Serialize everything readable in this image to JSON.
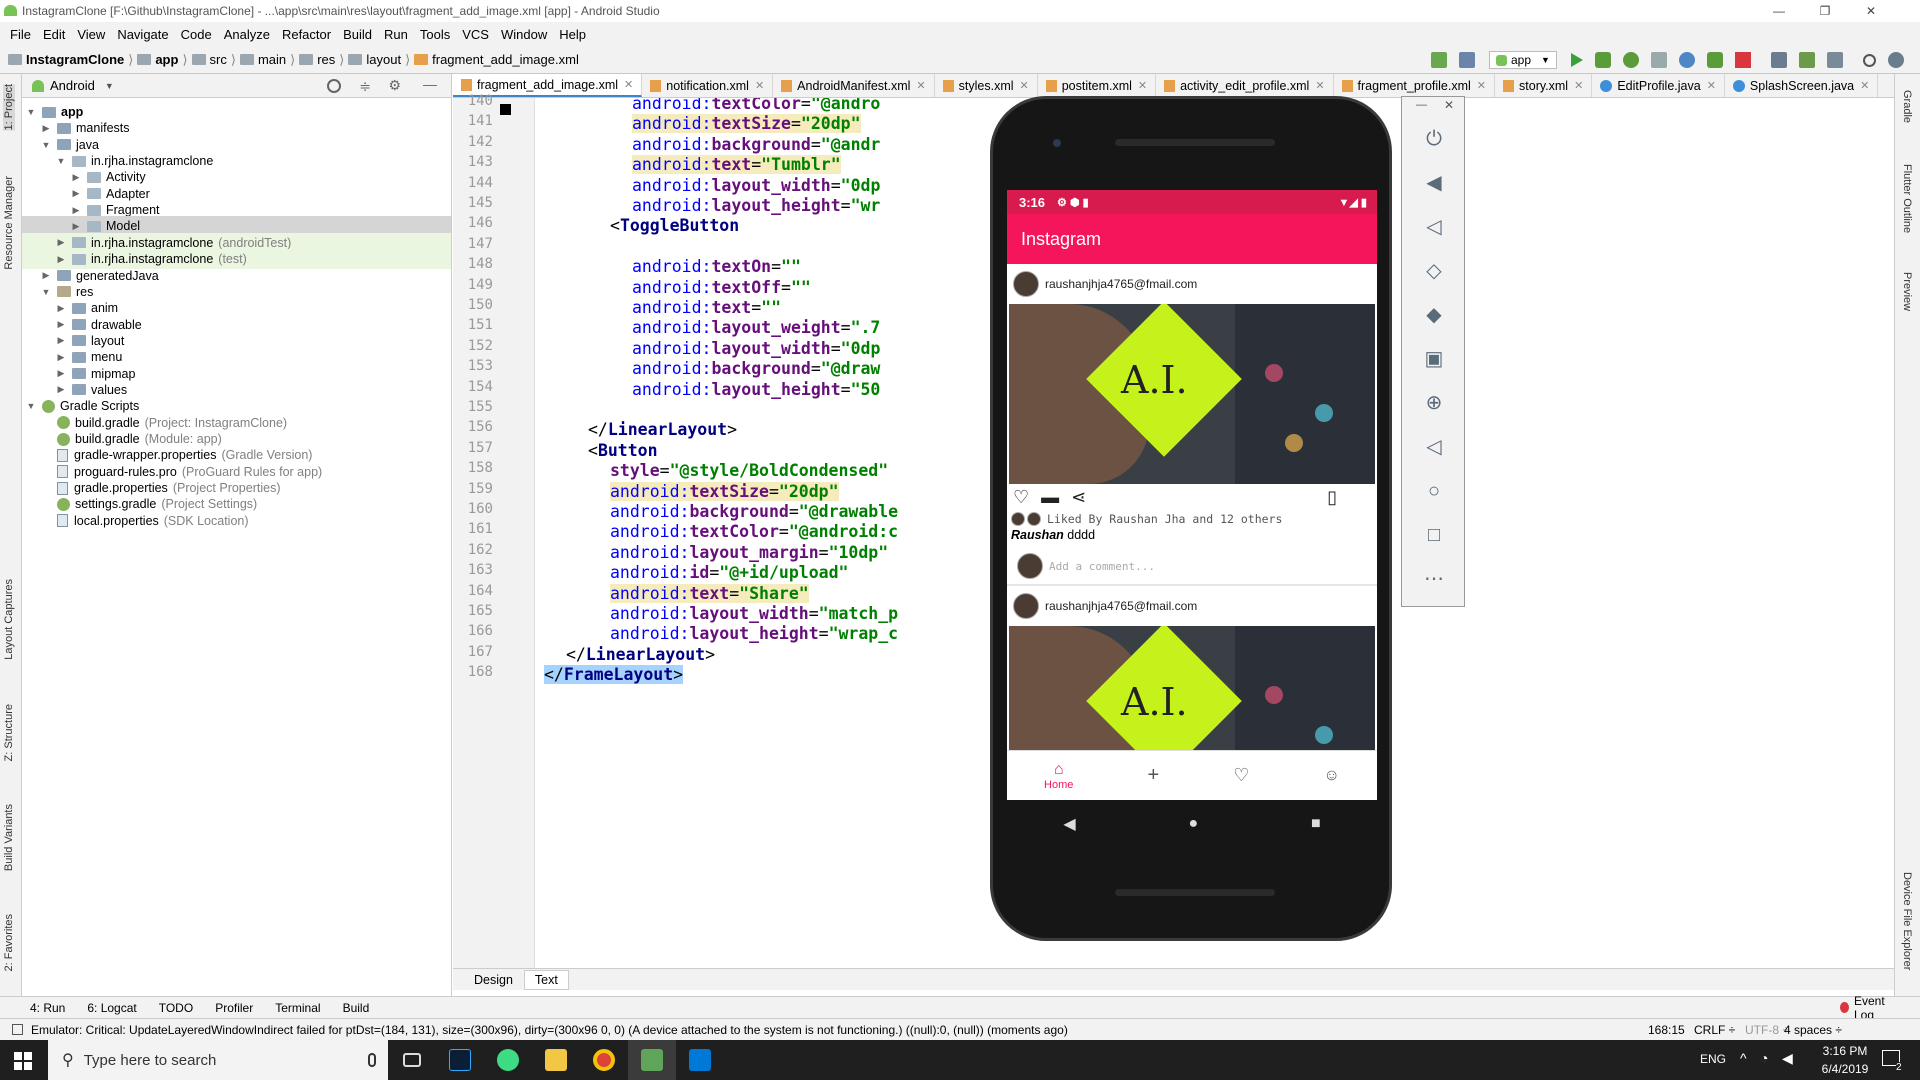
{
  "window": {
    "title": "InstagramClone [F:\\Github\\InstagramClone] - ...\\app\\src\\main\\res\\layout\\fragment_add_image.xml [app] - Android Studio",
    "controls": [
      "—",
      "❐",
      "✕"
    ]
  },
  "menu": [
    "File",
    "Edit",
    "View",
    "Navigate",
    "Code",
    "Analyze",
    "Refactor",
    "Build",
    "Run",
    "Tools",
    "VCS",
    "Window",
    "Help"
  ],
  "breadcrumb": [
    "InstagramClone",
    "app",
    "src",
    "main",
    "res",
    "layout",
    "fragment_add_image.xml"
  ],
  "run_config": "app",
  "left_tools": [
    "1: Project",
    "Resource Manager",
    "Layout Captures",
    "Z: Structure",
    "Build Variants",
    "2: Favorites"
  ],
  "project": {
    "view_selector": "Android",
    "tree": [
      {
        "label": "app",
        "level": 0,
        "arrow": "▼",
        "icon": "fold",
        "bold": true
      },
      {
        "label": "manifests",
        "level": 1,
        "arrow": "▶",
        "icon": "fold"
      },
      {
        "label": "java",
        "level": 1,
        "arrow": "▼",
        "icon": "fold"
      },
      {
        "label": "in.rjha.instagramclone",
        "level": 2,
        "arrow": "▼",
        "icon": "pkg"
      },
      {
        "label": "Activity",
        "level": 3,
        "arrow": "▶",
        "icon": "pkg"
      },
      {
        "label": "Adapter",
        "level": 3,
        "arrow": "▶",
        "icon": "pkg"
      },
      {
        "label": "Fragment",
        "level": 3,
        "arrow": "▶",
        "icon": "pkg"
      },
      {
        "label": "Model",
        "level": 3,
        "arrow": "▶",
        "icon": "pkg",
        "selected": true
      },
      {
        "label": "in.rjha.instagramclone",
        "hint": "(androidTest)",
        "level": 2,
        "arrow": "▶",
        "icon": "pkg",
        "green": true
      },
      {
        "label": "in.rjha.instagramclone",
        "hint": "(test)",
        "level": 2,
        "arrow": "▶",
        "icon": "pkg",
        "green": true
      },
      {
        "label": "generatedJava",
        "level": 1,
        "arrow": "▶",
        "icon": "fold"
      },
      {
        "label": "res",
        "level": 1,
        "arrow": "▼",
        "icon": "res"
      },
      {
        "label": "anim",
        "level": 2,
        "arrow": "▶",
        "icon": "fold"
      },
      {
        "label": "drawable",
        "level": 2,
        "arrow": "▶",
        "icon": "fold"
      },
      {
        "label": "layout",
        "level": 2,
        "arrow": "▶",
        "icon": "fold"
      },
      {
        "label": "menu",
        "level": 2,
        "arrow": "▶",
        "icon": "fold"
      },
      {
        "label": "mipmap",
        "level": 2,
        "arrow": "▶",
        "icon": "fold"
      },
      {
        "label": "values",
        "level": 2,
        "arrow": "▶",
        "icon": "fold"
      },
      {
        "label": "Gradle Scripts",
        "level": 0,
        "arrow": "▼",
        "icon": "gr"
      },
      {
        "label": "build.gradle",
        "hint": "(Project: InstagramClone)",
        "level": 1,
        "arrow": "",
        "icon": "gr"
      },
      {
        "label": "build.gradle",
        "hint": "(Module: app)",
        "level": 1,
        "arrow": "",
        "icon": "gr"
      },
      {
        "label": "gradle-wrapper.properties",
        "hint": "(Gradle Version)",
        "level": 1,
        "arrow": "",
        "icon": "file"
      },
      {
        "label": "proguard-rules.pro",
        "hint": "(ProGuard Rules for app)",
        "level": 1,
        "arrow": "",
        "icon": "file"
      },
      {
        "label": "gradle.properties",
        "hint": "(Project Properties)",
        "level": 1,
        "arrow": "",
        "icon": "file"
      },
      {
        "label": "settings.gradle",
        "hint": "(Project Settings)",
        "level": 1,
        "arrow": "",
        "icon": "gr"
      },
      {
        "label": "local.properties",
        "hint": "(SDK Location)",
        "level": 1,
        "arrow": "",
        "icon": "file"
      }
    ]
  },
  "tabs": [
    {
      "label": "fragment_add_image.xml",
      "active": true,
      "kind": "xml"
    },
    {
      "label": "notification.xml",
      "kind": "xml"
    },
    {
      "label": "AndroidManifest.xml",
      "kind": "xml"
    },
    {
      "label": "styles.xml",
      "kind": "xml"
    },
    {
      "label": "postitem.xml",
      "kind": "xml"
    },
    {
      "label": "activity_edit_profile.xml",
      "kind": "xml"
    },
    {
      "label": "fragment_profile.xml",
      "kind": "xml"
    },
    {
      "label": "story.xml",
      "kind": "xml"
    },
    {
      "label": "EditProfile.java",
      "kind": "java"
    },
    {
      "label": "SplashScreen.java",
      "kind": "java"
    }
  ],
  "code": [
    {
      "n": 140,
      "indent": 8,
      "parts": [
        [
          "at2",
          "android:"
        ],
        [
          "at",
          "textColor"
        ],
        [
          "",
          "="
        ],
        [
          "val",
          "\"@andro"
        ]
      ]
    },
    {
      "n": 141,
      "indent": 8,
      "hl": true,
      "parts": [
        [
          "at2",
          "android:"
        ],
        [
          "at",
          "textSize"
        ],
        [
          "",
          "="
        ],
        [
          "val",
          "\"20dp\""
        ]
      ]
    },
    {
      "n": 142,
      "indent": 8,
      "parts": [
        [
          "at2",
          "android:"
        ],
        [
          "at",
          "background"
        ],
        [
          "",
          "="
        ],
        [
          "val",
          "\"@andr"
        ]
      ]
    },
    {
      "n": 143,
      "indent": 8,
      "hl": true,
      "parts": [
        [
          "at2",
          "android:"
        ],
        [
          "at",
          "text"
        ],
        [
          "",
          "="
        ],
        [
          "val",
          "\"Tumblr\""
        ]
      ]
    },
    {
      "n": 144,
      "indent": 8,
      "parts": [
        [
          "at2",
          "android:"
        ],
        [
          "at",
          "layout_width"
        ],
        [
          "",
          "="
        ],
        [
          "val",
          "\"0dp"
        ]
      ]
    },
    {
      "n": 145,
      "indent": 8,
      "parts": [
        [
          "at2",
          "android:"
        ],
        [
          "at",
          "layout_height"
        ],
        [
          "",
          "="
        ],
        [
          "val",
          "\"wr"
        ]
      ]
    },
    {
      "n": 146,
      "indent": 6,
      "parts": [
        [
          "",
          "<"
        ],
        [
          "tag",
          "ToggleButton"
        ]
      ]
    },
    {
      "n": 147,
      "indent": 0,
      "parts": []
    },
    {
      "n": 148,
      "indent": 8,
      "parts": [
        [
          "at2",
          "android:"
        ],
        [
          "at",
          "textOn"
        ],
        [
          "",
          "="
        ],
        [
          "val",
          "\"\""
        ]
      ]
    },
    {
      "n": 149,
      "indent": 8,
      "parts": [
        [
          "at2",
          "android:"
        ],
        [
          "at",
          "textOff"
        ],
        [
          "",
          "="
        ],
        [
          "val",
          "\"\""
        ]
      ]
    },
    {
      "n": 150,
      "indent": 8,
      "parts": [
        [
          "at2",
          "android:"
        ],
        [
          "at",
          "text"
        ],
        [
          "",
          "="
        ],
        [
          "val",
          "\"\""
        ]
      ]
    },
    {
      "n": 151,
      "indent": 8,
      "parts": [
        [
          "at2",
          "android:"
        ],
        [
          "at",
          "layout_weight"
        ],
        [
          "",
          "="
        ],
        [
          "val",
          "\".7"
        ]
      ]
    },
    {
      "n": 152,
      "indent": 8,
      "parts": [
        [
          "at2",
          "android:"
        ],
        [
          "at",
          "layout_width"
        ],
        [
          "",
          "="
        ],
        [
          "val",
          "\"0dp"
        ]
      ]
    },
    {
      "n": 153,
      "indent": 8,
      "parts": [
        [
          "at2",
          "android:"
        ],
        [
          "at",
          "background"
        ],
        [
          "",
          "="
        ],
        [
          "val",
          "\"@draw"
        ]
      ]
    },
    {
      "n": 154,
      "indent": 8,
      "parts": [
        [
          "at2",
          "android:"
        ],
        [
          "at",
          "layout_height"
        ],
        [
          "",
          "="
        ],
        [
          "val",
          "\"50"
        ]
      ]
    },
    {
      "n": 155,
      "indent": 0,
      "parts": []
    },
    {
      "n": 156,
      "indent": 4,
      "parts": [
        [
          "",
          "</"
        ],
        [
          "tag",
          "LinearLayout"
        ],
        [
          "",
          ">"
        ]
      ]
    },
    {
      "n": 157,
      "indent": 4,
      "parts": [
        [
          "",
          "<"
        ],
        [
          "tag",
          "Button"
        ]
      ]
    },
    {
      "n": 158,
      "indent": 6,
      "parts": [
        [
          "at",
          "style"
        ],
        [
          "",
          "="
        ],
        [
          "val",
          "\"@style/BoldCondensed\""
        ]
      ]
    },
    {
      "n": 159,
      "indent": 6,
      "hl": true,
      "parts": [
        [
          "at2",
          "android:"
        ],
        [
          "at",
          "textSize"
        ],
        [
          "",
          "="
        ],
        [
          "val",
          "\"20dp\""
        ]
      ]
    },
    {
      "n": 160,
      "indent": 6,
      "parts": [
        [
          "at2",
          "android:"
        ],
        [
          "at",
          "background"
        ],
        [
          "",
          "="
        ],
        [
          "val",
          "\"@drawable"
        ]
      ]
    },
    {
      "n": 161,
      "indent": 6,
      "parts": [
        [
          "at2",
          "android:"
        ],
        [
          "at",
          "textColor"
        ],
        [
          "",
          "="
        ],
        [
          "val",
          "\"@android:c"
        ]
      ]
    },
    {
      "n": 162,
      "indent": 6,
      "parts": [
        [
          "at2",
          "android:"
        ],
        [
          "at",
          "layout_margin"
        ],
        [
          "",
          "="
        ],
        [
          "val",
          "\"10dp\""
        ]
      ]
    },
    {
      "n": 163,
      "indent": 6,
      "parts": [
        [
          "at2",
          "android:"
        ],
        [
          "at",
          "id"
        ],
        [
          "",
          "="
        ],
        [
          "val",
          "\"@+id/upload\""
        ]
      ]
    },
    {
      "n": 164,
      "indent": 6,
      "hl": true,
      "parts": [
        [
          "at2",
          "android:"
        ],
        [
          "at",
          "text"
        ],
        [
          "",
          "="
        ],
        [
          "val",
          "\"Share\""
        ]
      ]
    },
    {
      "n": 165,
      "indent": 6,
      "parts": [
        [
          "at2",
          "android:"
        ],
        [
          "at",
          "layout_width"
        ],
        [
          "",
          "="
        ],
        [
          "val",
          "\"match_p"
        ]
      ]
    },
    {
      "n": 166,
      "indent": 6,
      "parts": [
        [
          "at2",
          "android:"
        ],
        [
          "at",
          "layout_height"
        ],
        [
          "",
          "="
        ],
        [
          "val",
          "\"wrap_c"
        ]
      ]
    },
    {
      "n": 167,
      "indent": 2,
      "parts": [
        [
          "",
          "</"
        ],
        [
          "tag",
          "LinearLayout"
        ],
        [
          "",
          ">"
        ]
      ]
    },
    {
      "n": 168,
      "indent": 0,
      "sel": true,
      "parts": [
        [
          "",
          "</"
        ],
        [
          "tag",
          "FrameLayout"
        ],
        [
          "",
          ">"
        ]
      ]
    }
  ],
  "design_tabs": [
    "Design",
    "Text"
  ],
  "right_tools": [
    "Gradle",
    "Flutter Outline",
    "Preview",
    "Device File Explorer"
  ],
  "bottom_tools": [
    "4: Run",
    "6: Logcat",
    "TODO",
    "Profiler",
    "Terminal",
    "Build"
  ],
  "event_log": "Event Log",
  "status": {
    "message": "Emulator: Critical: UpdateLayeredWindowIndirect failed for ptDst=(184, 131), size=(300x96), dirty=(300x96 0, 0) (A device attached to the system is not functioning.) ((null):0, (null)) (moments ago)",
    "position": "168:15",
    "line_sep": "CRLF ÷",
    "encoding": "UTF-8 ÷",
    "indent": "4 spaces ÷"
  },
  "phone": {
    "time": "3:16",
    "app_title": "Instagram",
    "posts": [
      {
        "user": "raushanjhja4765@fmail.com",
        "sign_text": "A.I.",
        "liked_by": "Liked By Raushan Jha and 12 others",
        "caption_user": "Raushan",
        "caption": "dddd",
        "comment_placeholder": "Add a comment..."
      },
      {
        "user": "raushanjhja4765@fmail.com",
        "sign_text": "A.I."
      }
    ],
    "nav": {
      "home_label": "Home"
    }
  },
  "taskbar": {
    "search_placeholder": "Type here to search",
    "lang": "ENG",
    "time": "3:16 PM",
    "date": "6/4/2019",
    "notif_count": "2"
  },
  "colors": {
    "accent": "#f4155a",
    "status": "#d81b4e",
    "selection": "#a6d2ff",
    "highlight": "#f6ebbc"
  }
}
